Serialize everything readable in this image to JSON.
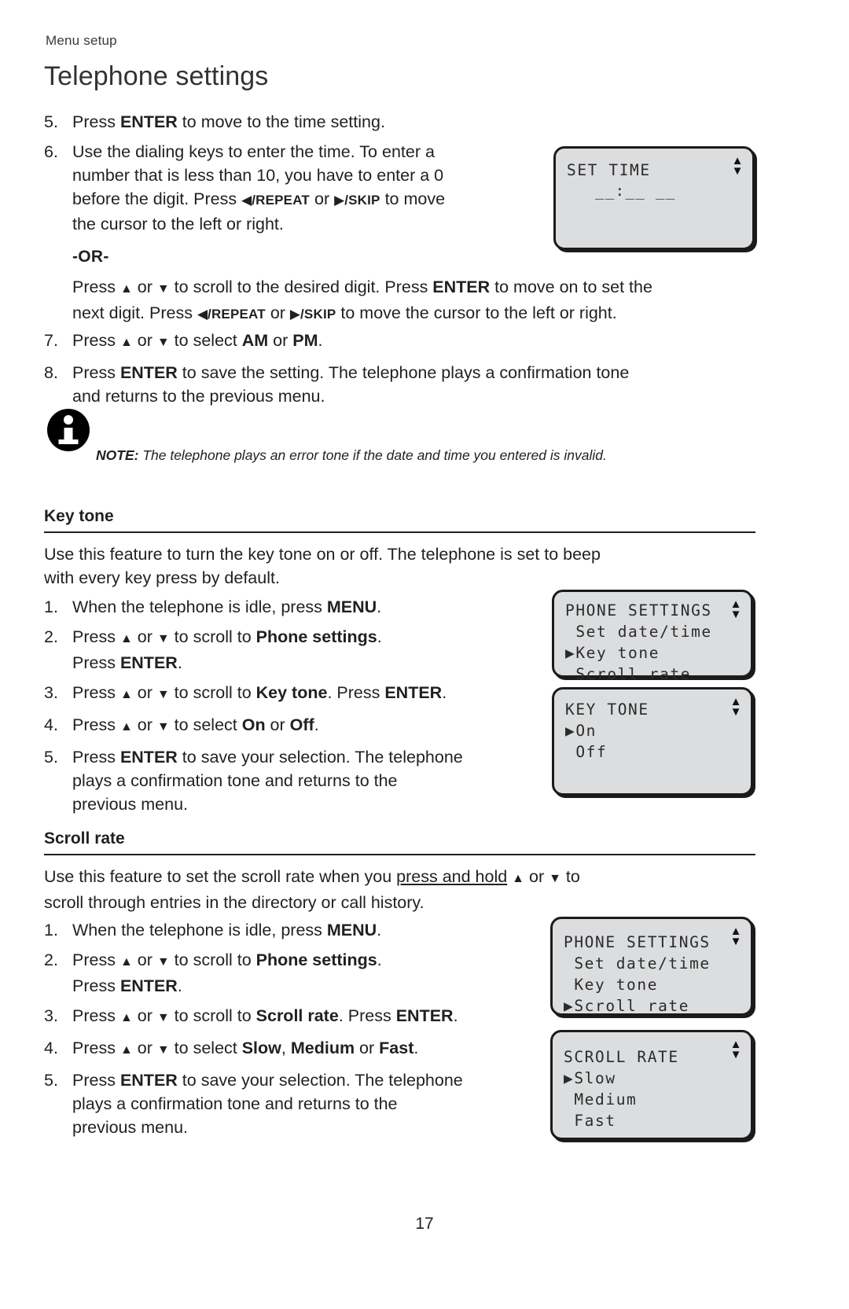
{
  "header": {
    "running_head": "Menu setup",
    "title": "Telephone settings"
  },
  "set_time_steps": {
    "step5": {
      "num": "5.",
      "t1": "Press ",
      "b1": "ENTER",
      "t2": " to move to the time setting."
    },
    "step6": {
      "num": "6.",
      "l1": "Use the dialing keys to enter the time. To enter a",
      "l2": "number that is less than 10, you have to enter a 0",
      "l3a": "before the digit. Press ",
      "l3b": "/REPEAT",
      "l3c": " or ",
      "l3d": "/SKIP",
      "l3e": " to move",
      "l4": "the cursor to the left or right."
    },
    "or_label": "-OR-",
    "or_body": {
      "p1": "Press ",
      "p2": " or ",
      "p3": " to scroll to the desired digit. Press ",
      "p4": "ENTER",
      "p5": " to move on to set the",
      "p6": "next digit. Press ",
      "p7": "/REPEAT",
      "p8": " or ",
      "p9": "/SKIP",
      "p10": " to move the cursor to the left or right."
    },
    "step7": {
      "num": "7.",
      "t1": "Press ",
      "t2": " or ",
      "t3": " to select ",
      "b1": "AM",
      "t4": " or ",
      "b2": "PM",
      "t5": "."
    },
    "step8": {
      "num": "8.",
      "t1": "Press ",
      "b1": "ENTER",
      "t2": " to save the setting. The telephone plays a confirmation tone",
      "l2": "and returns to the previous menu."
    }
  },
  "note": {
    "icon": "info-icon",
    "label": "NOTE:",
    "text": " The telephone plays an error tone if the date and time you entered is invalid."
  },
  "key_tone": {
    "heading": "Key tone",
    "intro_l1": "Use this feature to turn the key tone on or off. The telephone is set to beep",
    "intro_l2": "with every key press by default.",
    "steps": {
      "s1": {
        "num": "1.",
        "t1": "When the telephone is idle, press ",
        "b1": "MENU",
        "t2": "."
      },
      "s2": {
        "num": "2.",
        "t1": "Press ",
        "t2": " or ",
        "t3": " to scroll to ",
        "b1": "Phone settings",
        "t4": ".",
        "l2a": "Press ",
        "l2b": "ENTER",
        "l2c": "."
      },
      "s3": {
        "num": "3.",
        "t1": "Press ",
        "t2": " or ",
        "t3": " to scroll to ",
        "b1": "Key tone",
        "t4": ". Press ",
        "b2": "ENTER",
        "t5": "."
      },
      "s4": {
        "num": "4.",
        "t1": "Press ",
        "t2": " or ",
        "t3": " to select ",
        "b1": "On",
        "t4": " or ",
        "b2": "Off",
        "t5": "."
      },
      "s5": {
        "num": "5.",
        "t1": "Press ",
        "b1": "ENTER",
        "t2": " to save your selection. The telephone",
        "l2": "plays a confirmation tone and returns to the",
        "l3": "previous menu."
      }
    }
  },
  "scroll_rate": {
    "heading": "Scroll rate",
    "intro_a": "Use this feature to set the scroll rate when you ",
    "intro_underline": "press and hold",
    "intro_b": " ",
    "intro_c": " or ",
    "intro_d": " to",
    "intro_l2": "scroll through entries in the directory or call history.",
    "steps": {
      "s1": {
        "num": "1.",
        "t1": "When the telephone is idle, press ",
        "b1": "MENU",
        "t2": "."
      },
      "s2": {
        "num": "2.",
        "t1": "Press ",
        "t2": " or ",
        "t3": " to scroll to ",
        "b1": "Phone settings",
        "t4": ".",
        "l2a": "Press ",
        "l2b": "ENTER",
        "l2c": "."
      },
      "s3": {
        "num": "3.",
        "t1": "Press ",
        "t2": " or ",
        "t3": " to scroll to ",
        "b1": "Scroll rate",
        "t4": ". Press ",
        "b2": "ENTER",
        "t5": "."
      },
      "s4": {
        "num": "4.",
        "t1": "Press ",
        "t2": " or ",
        "t3": " to select ",
        "b1": "Slow",
        "t4": ", ",
        "b2": "Medium",
        "t5": " or ",
        "b3": "Fast",
        "t6": "."
      },
      "s5": {
        "num": "5.",
        "t1": "Press ",
        "b1": "ENTER",
        "t2": " to save your selection. The telephone",
        "l2": "plays a confirmation tone and returns to the",
        "l3": "previous menu."
      }
    }
  },
  "lcd_screens": {
    "set_time": {
      "title": "SET TIME",
      "value": "__:__ __",
      "colon": ":",
      "scroll_up": "▲",
      "scroll_down": "▼"
    },
    "phone_settings_key": {
      "title": "PHONE SETTINGS",
      "items": [
        {
          "cursor": " ",
          "label": "Set date/time"
        },
        {
          "cursor": "▶",
          "label": "Key tone"
        },
        {
          "cursor": " ",
          "label": "Scroll rate"
        }
      ],
      "scroll_up": "▲",
      "scroll_down": "▼"
    },
    "key_tone_menu": {
      "title": "KEY TONE",
      "items": [
        {
          "cursor": "▶",
          "label": "On"
        },
        {
          "cursor": " ",
          "label": "Off"
        }
      ],
      "scroll_up": "▲",
      "scroll_down": "▼"
    },
    "phone_settings_scroll": {
      "title": "PHONE SETTINGS",
      "items": [
        {
          "cursor": " ",
          "label": "Set date/time"
        },
        {
          "cursor": " ",
          "label": "Key tone"
        },
        {
          "cursor": "▶",
          "label": "Scroll rate"
        }
      ],
      "scroll_up": "▲",
      "scroll_down": "▼"
    },
    "scroll_rate_menu": {
      "title": "SCROLL RATE",
      "items": [
        {
          "cursor": "▶",
          "label": "Slow"
        },
        {
          "cursor": " ",
          "label": "Medium"
        },
        {
          "cursor": " ",
          "label": "Fast"
        }
      ],
      "scroll_up": "▲",
      "scroll_down": "▼"
    }
  },
  "footer": {
    "page_number": "17"
  }
}
